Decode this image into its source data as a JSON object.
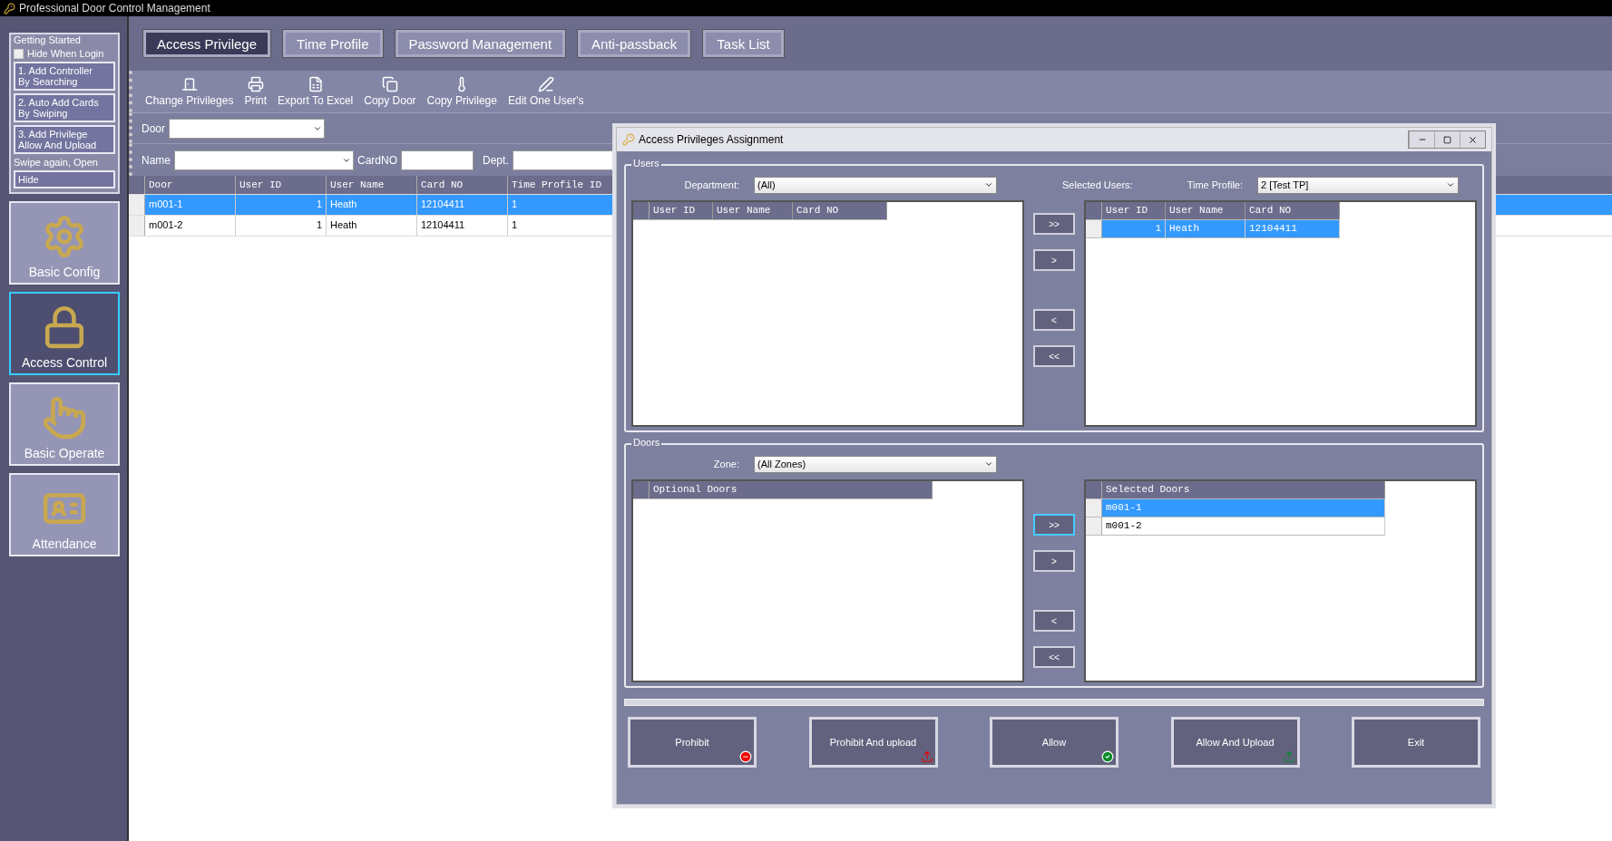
{
  "window": {
    "title": "Professional Door Control Management"
  },
  "getting_started": {
    "title": "Getting Started",
    "hide_when_login": {
      "label": "Hide When Login",
      "checked": false
    },
    "steps": [
      {
        "lines": [
          "1. Add Controller",
          "By Searching"
        ]
      },
      {
        "lines": [
          "2. Auto Add Cards",
          "By Swiping"
        ]
      },
      {
        "lines": [
          "3. Add Privilege",
          "Allow And Upload"
        ]
      }
    ],
    "swipe_note": "Swipe again, Open",
    "hide_button": "Hide"
  },
  "modules": [
    {
      "label": "Basic Config",
      "kind": "gear",
      "selected": false
    },
    {
      "label": "Access Control",
      "kind": "lock",
      "selected": true
    },
    {
      "label": "Basic Operate",
      "kind": "hand",
      "selected": false
    },
    {
      "label": "Attendance",
      "kind": "badge",
      "selected": false
    }
  ],
  "tabs": [
    {
      "label": "Access Privilege",
      "selected": true
    },
    {
      "label": "Time Profile",
      "selected": false
    },
    {
      "label": "Password Management",
      "selected": false
    },
    {
      "label": "Anti-passback",
      "selected": false
    },
    {
      "label": "Task List",
      "selected": false
    }
  ],
  "toolbar": [
    {
      "label": "Change Privileges",
      "kind": "door"
    },
    {
      "label": "Print",
      "kind": "print"
    },
    {
      "label": "Export To Excel",
      "kind": "excel"
    },
    {
      "label": "Copy Door",
      "kind": "copy"
    },
    {
      "label": "Copy Privilege",
      "kind": "privilege"
    },
    {
      "label": "Edit One User's",
      "kind": "edit"
    }
  ],
  "filters": {
    "door": "Door",
    "name": "Name",
    "card_no": "CardNO",
    "dept": "Dept."
  },
  "table": {
    "columns": [
      "Door",
      "User ID",
      "User Name",
      "Card NO",
      "Time Profile ID"
    ],
    "rows": [
      {
        "selected": true,
        "cells": [
          "m001-1",
          "1",
          "Heath",
          "12104411",
          "1"
        ]
      },
      {
        "selected": false,
        "cells": [
          "m001-2",
          "1",
          "Heath",
          "12104411",
          "1"
        ]
      }
    ]
  },
  "dialog": {
    "title": "Access Privileges Assignment",
    "users": {
      "title": "Users",
      "department_label": "Department:",
      "department_value": "(All)",
      "available_columns": [
        "User ID",
        "User Name",
        "Card NO"
      ],
      "selected_label": "Selected Users:",
      "time_profile_label": "Time Profile:",
      "time_profile_value": "2 [Test TP]",
      "selected_columns": [
        "User ID",
        "User Name",
        "Card NO"
      ],
      "selected_rows": [
        {
          "selected": true,
          "cells": [
            "1",
            "Heath",
            "12104411"
          ]
        }
      ],
      "move_buttons": [
        {
          "label": ">>",
          "focused": false
        },
        {
          "label": ">",
          "focused": false
        },
        {
          "label": "<",
          "focused": false
        },
        {
          "label": "<<",
          "focused": false
        }
      ]
    },
    "doors": {
      "title": "Doors",
      "zone_label": "Zone:",
      "zone_value": "(All Zones)",
      "available_columns": [
        "Optional Doors"
      ],
      "selected_columns": [
        "Selected Doors"
      ],
      "selected_rows": [
        {
          "selected": true,
          "cells": [
            "m001-1"
          ]
        },
        {
          "selected": false,
          "cells": [
            "m001-2"
          ]
        }
      ],
      "move_buttons": [
        {
          "label": ">>",
          "focused": true
        },
        {
          "label": ">",
          "focused": false
        },
        {
          "label": "<",
          "focused": false
        },
        {
          "label": "<<",
          "focused": false
        }
      ]
    },
    "actions": [
      {
        "label": "Prohibit",
        "kind": "prohibit"
      },
      {
        "label": "Prohibit And upload",
        "kind": "prohibit_upload"
      },
      {
        "label": "Allow",
        "kind": "allow"
      },
      {
        "label": "Allow And Upload",
        "kind": "allow_upload"
      },
      {
        "label": "Exit",
        "kind": "exit"
      }
    ]
  }
}
